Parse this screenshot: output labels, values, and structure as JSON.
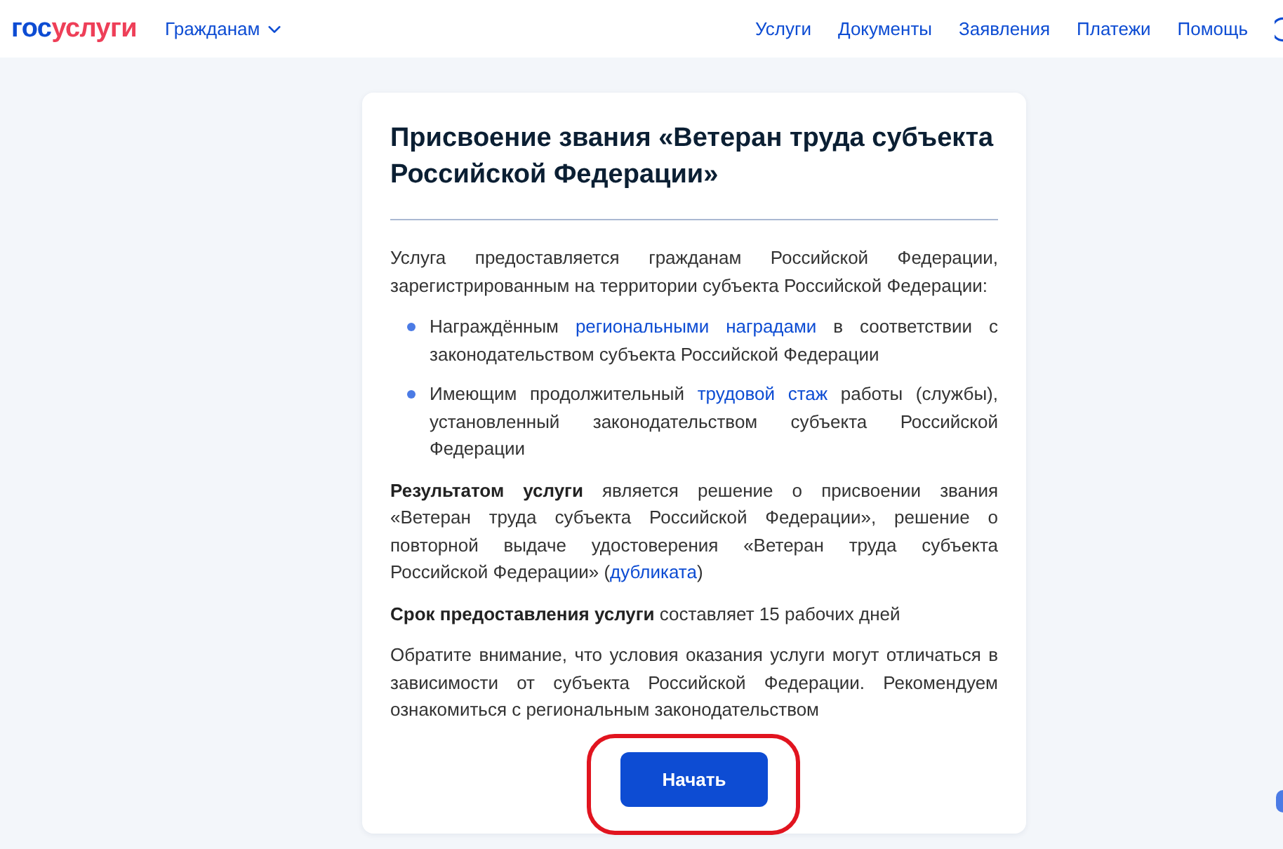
{
  "header": {
    "logo": [
      {
        "text": "гос",
        "color": "#0d4cd3"
      },
      {
        "text": "услуги",
        "color": "#ee3f58"
      }
    ],
    "audience_menu": {
      "label": "Гражданам"
    },
    "nav": [
      "Услуги",
      "Документы",
      "Заявления",
      "Платежи",
      "Помощь"
    ]
  },
  "card": {
    "title": "Присвоение звания «Ветеран труда субъекта Российской Федерации»",
    "blocks": [
      {
        "kind": "paragraph",
        "segments": [
          {
            "kind": "text",
            "text": "Услуга предоставляется гражданам Российской Федерации, зарегистрированным на территории субъекта Российской Федерации:"
          }
        ]
      },
      {
        "kind": "list",
        "items": [
          {
            "segments": [
              {
                "kind": "text",
                "text": "Награждённым "
              },
              {
                "kind": "link",
                "text": "региональными наградами"
              },
              {
                "kind": "text",
                "text": " в соответствии с законодательством субъекта Российской Федерации"
              }
            ]
          },
          {
            "segments": [
              {
                "kind": "text",
                "text": "Имеющим продолжительный "
              },
              {
                "kind": "link",
                "text": "трудовой стаж"
              },
              {
                "kind": "text",
                "text": " работы (службы), установленный законодательством субъекта Российской Федерации"
              }
            ]
          }
        ]
      },
      {
        "kind": "paragraph",
        "segments": [
          {
            "kind": "bold",
            "text": "Результатом услуги"
          },
          {
            "kind": "text",
            "text": " является решение о присвоении звания «Ветеран труда субъекта Российской Федерации», решение о повторной выдаче удостоверения «Ветеран труда субъекта Российской Федерации» ("
          },
          {
            "kind": "link",
            "text": "дубликата"
          },
          {
            "kind": "text",
            "text": ")"
          }
        ]
      },
      {
        "kind": "paragraph",
        "segments": [
          {
            "kind": "bold",
            "text": "Срок предоставления услуги"
          },
          {
            "kind": "text",
            "text": " составляет 15 рабочих дней"
          }
        ]
      },
      {
        "kind": "paragraph",
        "segments": [
          {
            "kind": "text",
            "text": "Обратите внимание, что условия оказания услуги могут отличаться в зависимости от субъекта Российской Федерации. Рекомендуем ознакомиться с региональным законодательством"
          }
        ]
      }
    ],
    "start_button": {
      "label": "Начать"
    },
    "annotation": {
      "kind": "ring"
    }
  }
}
